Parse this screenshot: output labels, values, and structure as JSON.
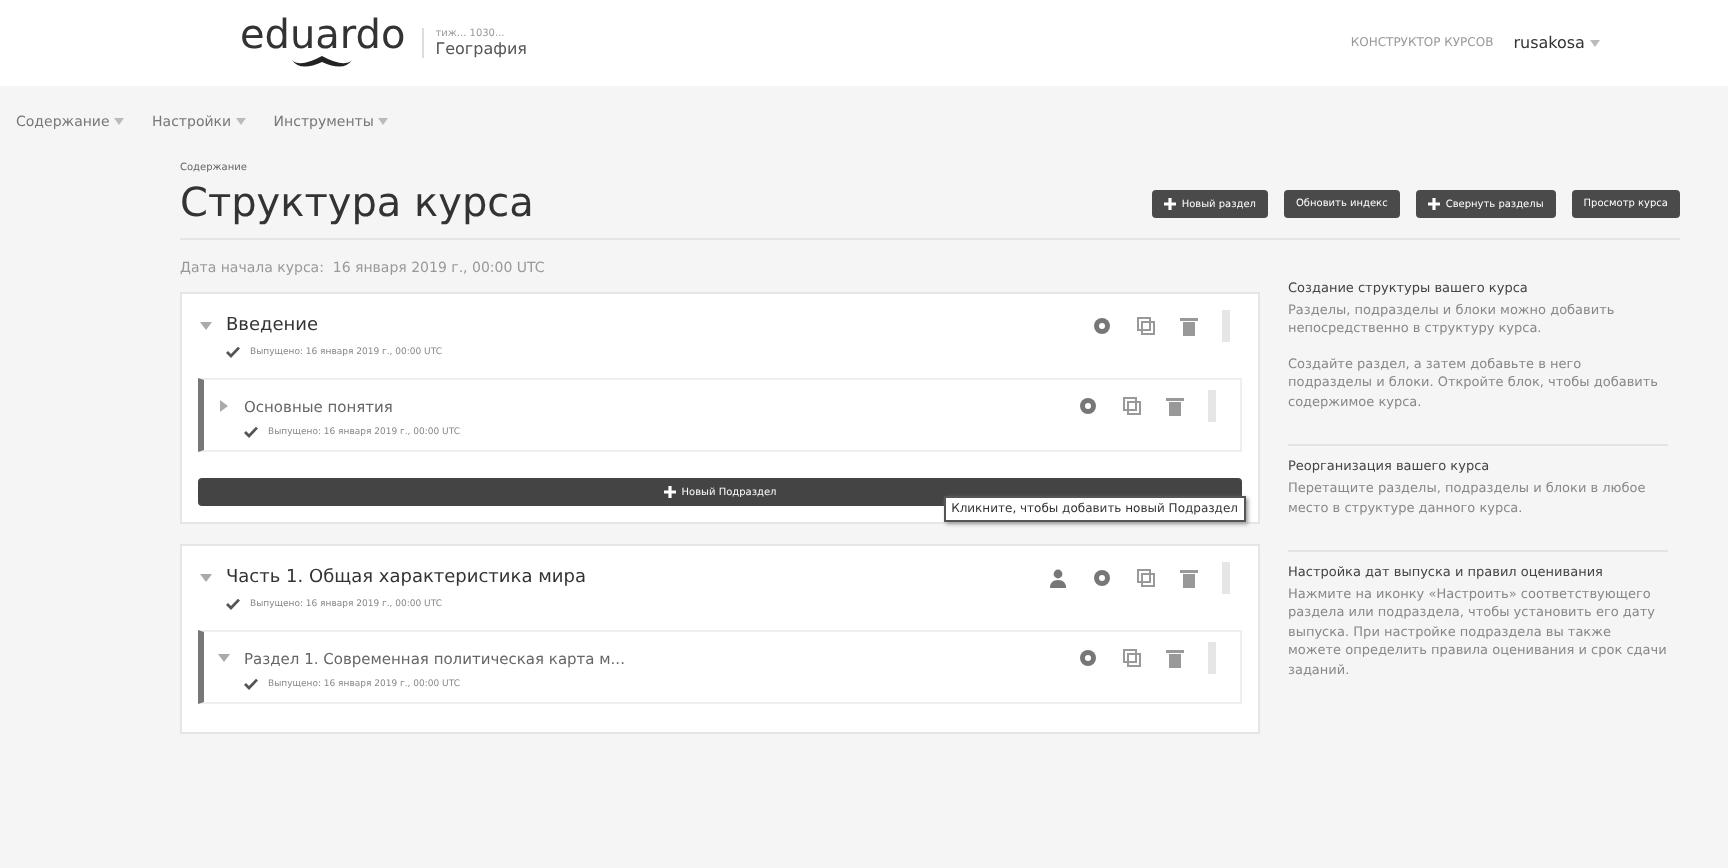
{
  "header": {
    "logo": "eduardo",
    "org": "тиж... 1030...",
    "course": "География",
    "studio_link": "КОНСТРУКТОР КУРСОВ",
    "user": "rusakosa"
  },
  "nav": [
    {
      "label": "Содержание"
    },
    {
      "label": "Настройки"
    },
    {
      "label": "Инструменты"
    }
  ],
  "page": {
    "breadcrumb": "Содержание",
    "title": "Структура курса"
  },
  "actions": [
    {
      "label": "Новый раздел",
      "kind": "plus"
    },
    {
      "label": "Обновить индекс",
      "kind": "plain"
    },
    {
      "label": "Свернуть разделы",
      "kind": "plus"
    },
    {
      "label": "Просмотр курса",
      "kind": "plain"
    }
  ],
  "start_date": {
    "label": "Дата начала курса:",
    "value": "16 января 2019 г., 00:00 UTC"
  },
  "sections": [
    {
      "title": "Введение",
      "expanded": true,
      "visibility_icon": false,
      "release": "Выпущено: 16 января 2019 г., 00:00 UTC",
      "subsections": [
        {
          "title": "Основные понятия",
          "expanded": false,
          "release": "Выпущено: 16 января 2019 г., 00:00 UTC"
        }
      ],
      "new_subsection": "Новый Подраздел"
    },
    {
      "title": "Часть 1. Общая характеристика мира",
      "expanded": true,
      "visibility_icon": true,
      "release": "Выпущено: 16 января 2019 г., 00:00 UTC",
      "subsections": [
        {
          "title": "Раздел 1. Современная политическая карта м...",
          "expanded": true,
          "release": "Выпущено: 16 января 2019 г., 00:00 UTC"
        }
      ]
    }
  ],
  "tooltip": "Кликните, чтобы добавить новый Подраздел",
  "sidebar": [
    {
      "heading": "Создание структуры вашего курса",
      "paragraphs": [
        "Разделы, подразделы и блоки можно добавить непосредственно в структуру курса.",
        "Создайте раздел, а затем добавьте в него подразделы и блоки. Откройте блок, чтобы добавить содержимое курса."
      ]
    },
    {
      "heading": "Реорганизация вашего курса",
      "paragraphs": [
        "Перетащите разделы, подразделы и блоки в любое место в структуре данного курса."
      ]
    },
    {
      "heading": "Настройка дат выпуска и правил оценивания",
      "paragraphs": [
        "Нажмите на иконку «Настроить» соответствующего раздела или подраздела, чтобы установить его дату выпуска. При настройке подраздела вы также можете определить правила оценивания и срок сдачи заданий."
      ]
    }
  ]
}
